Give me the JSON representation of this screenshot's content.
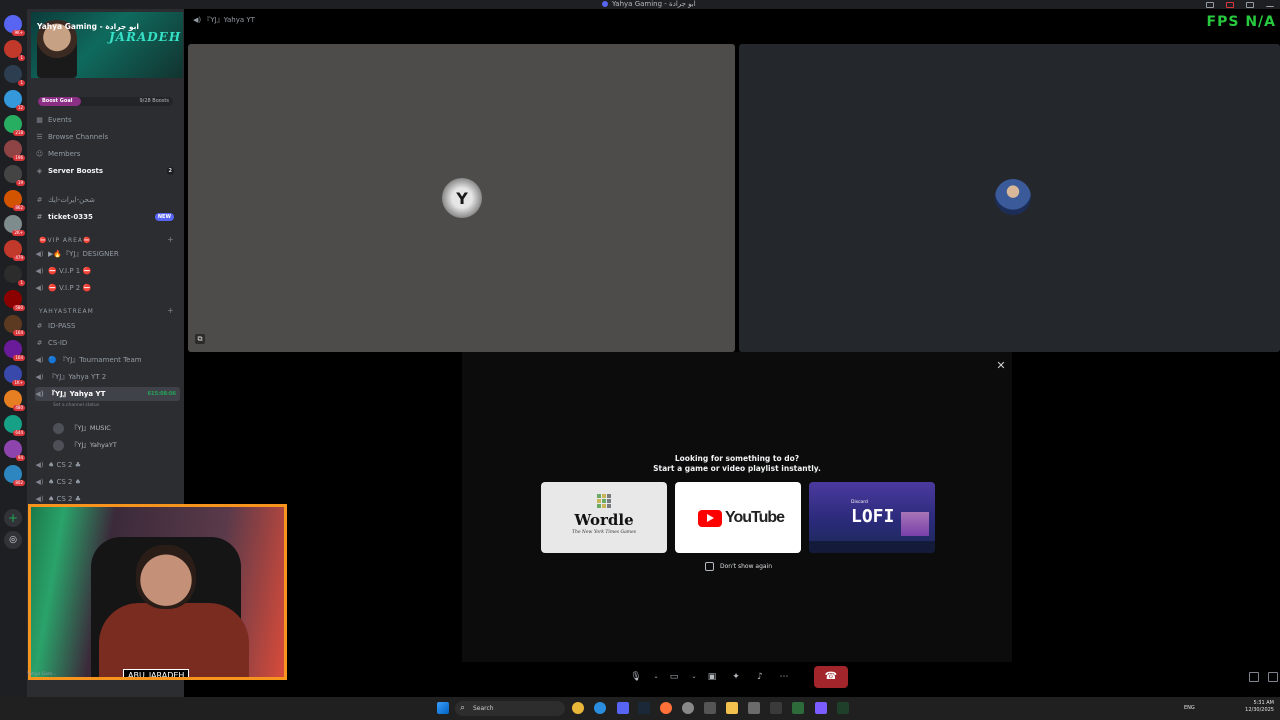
{
  "window": {
    "title": "Yahya Gaming - ابو جرادة"
  },
  "server": {
    "name": "Yahya Gaming - ابو جرادة",
    "banner_logo": "JARADEH",
    "boost_goal_label": "Boost Goal",
    "boost_progress_text": "9/28 Boosts",
    "boost_progress_fraction": 0.32
  },
  "sidebar": {
    "nav": [
      {
        "label": "Events",
        "icon": "calendar-icon"
      },
      {
        "label": "Browse Channels",
        "icon": "browse-icon"
      },
      {
        "label": "Members",
        "icon": "members-icon"
      },
      {
        "label": "Server Boosts",
        "icon": "boost-icon",
        "badge": "2"
      }
    ],
    "channels_top": [
      {
        "label": "شحن-ايرات-ايك",
        "icon": "hash-icon"
      },
      {
        "label": "ticket-0335",
        "icon": "hash-icon",
        "badge": "NEW"
      }
    ],
    "category_vip": "⛔VIP AREA⛔",
    "vip_channels": [
      {
        "label": "▶🔥『YJ』DESIGNER"
      },
      {
        "label": "⛔ V.I.P 1 ⛔"
      },
      {
        "label": "⛔ V.I.P 2 ⛔"
      }
    ],
    "category_stream": "YAHYASTREAM",
    "stream_channels": [
      {
        "label": "ID-PASS",
        "icon": "hash-icon"
      },
      {
        "label": "CS-ID",
        "icon": "hash-icon"
      },
      {
        "label": "🔵 『YJ』Tournament Team",
        "icon": "speaker-icon"
      },
      {
        "label": "『YJ』Yahya YT 2",
        "icon": "speaker-icon"
      }
    ],
    "active_channel": {
      "label": "『YJ』Yahya YT",
      "timer": "615:08:06",
      "status_hint": "Set a channel status"
    },
    "voice_members": [
      "『YJ』MUSIC",
      "『YJ』YahyaYT"
    ],
    "cs_channels": [
      "♠ CS 2 ♣",
      "♠ CS 2 ♠",
      "♠ CS 2 ♣"
    ]
  },
  "rail": {
    "servers": [
      {
        "color": "#5865f2",
        "badge": "9K+"
      },
      {
        "color": "#c0392b",
        "badge": "1"
      },
      {
        "color": "#2c3e50",
        "badge": "1"
      },
      {
        "color": "#3498db",
        "badge": "12"
      },
      {
        "color": "#27ae60",
        "badge": "218"
      },
      {
        "color": "#8e4444",
        "badge": "196"
      },
      {
        "color": "#444",
        "badge": "19"
      },
      {
        "color": "#d35400",
        "badge": "862"
      },
      {
        "color": "#7f8c8d",
        "badge": "2K+"
      },
      {
        "color": "#c0392b",
        "badge": "479"
      },
      {
        "color": "#2c2c2c",
        "badge": "1"
      },
      {
        "color": "#8b0000",
        "badge": "580"
      },
      {
        "color": "#5c3a21",
        "badge": "164"
      },
      {
        "color": "#6a1b9a",
        "badge": "164"
      },
      {
        "color": "#3949ab",
        "badge": "1K+"
      },
      {
        "color": "#e67e22",
        "badge": "480"
      },
      {
        "color": "#16a085",
        "badge": "644"
      },
      {
        "color": "#8e44ad",
        "badge": "94"
      },
      {
        "color": "#2e86c1",
        "badge": "802"
      }
    ]
  },
  "stage": {
    "channel_header": "『YJ』Yahya YT",
    "fps_overlay": "FPS N/A",
    "participant_a_initial": "Y"
  },
  "activity": {
    "line1": "Looking for something to do?",
    "line2": "Start a game or video playlist instantly.",
    "cards": {
      "wordle": {
        "name": "Wordle",
        "sub": "The New York Times Games"
      },
      "youtube": {
        "name": "YouTube"
      },
      "lofi": {
        "tag": "Discord",
        "name": "LOFI"
      }
    },
    "dont_show_again": "Don't show again"
  },
  "webcam": {
    "nametag": "ABU_JARADEH"
  },
  "user_strip": {
    "name": "Yahya Gam..."
  },
  "taskbar": {
    "search_placeholder": "Search",
    "lang": "ENG",
    "time": "5:31 AM",
    "date": "12/30/2025"
  }
}
